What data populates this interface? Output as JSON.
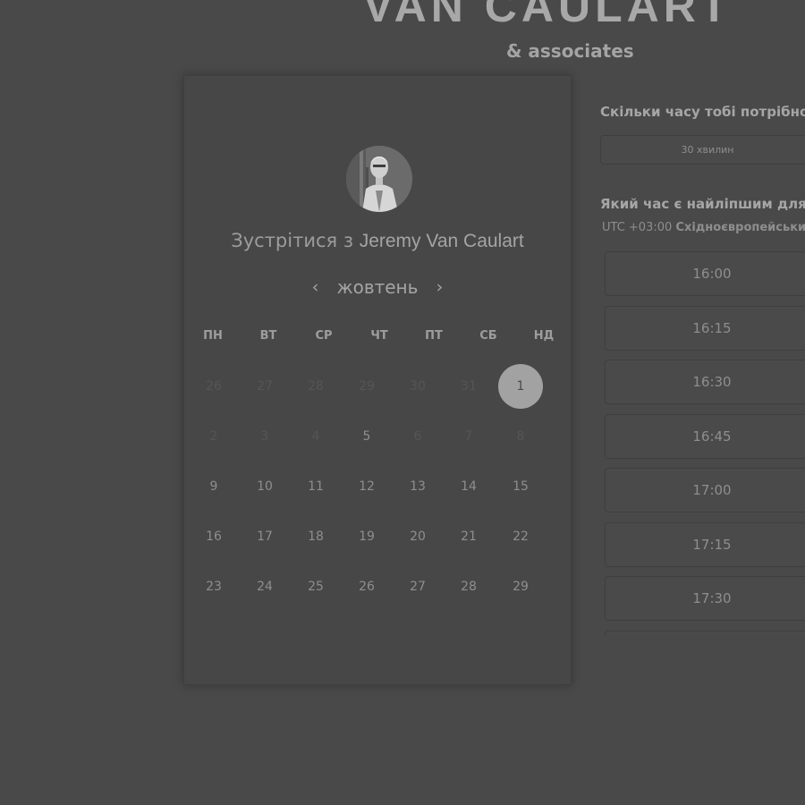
{
  "brand": {
    "name": "VAN CAULART",
    "tagline": "& associates"
  },
  "scheduler": {
    "title_prefix": "Зустрітися з",
    "host_name": "Jeremy Van Caulart",
    "calendar": {
      "month": "жовтень",
      "prev_icon": "chevron-left-icon",
      "next_icon": "chevron-right-icon",
      "weekdays": [
        "ПН",
        "ВТ",
        "СР",
        "ЧТ",
        "ПТ",
        "СБ",
        "НД"
      ],
      "weeks": [
        [
          {
            "d": "26",
            "s": "muted"
          },
          {
            "d": "27",
            "s": "muted"
          },
          {
            "d": "28",
            "s": "muted"
          },
          {
            "d": "29",
            "s": "muted"
          },
          {
            "d": "30",
            "s": "muted"
          },
          {
            "d": "31",
            "s": "muted"
          },
          {
            "d": "1",
            "s": "selected"
          }
        ],
        [
          {
            "d": "2",
            "s": "muted"
          },
          {
            "d": "3",
            "s": "muted"
          },
          {
            "d": "4",
            "s": "muted"
          },
          {
            "d": "5",
            "s": "avail"
          },
          {
            "d": "6",
            "s": "muted"
          },
          {
            "d": "7",
            "s": "muted"
          },
          {
            "d": "8",
            "s": "muted"
          }
        ],
        [
          {
            "d": "9",
            "s": "avail"
          },
          {
            "d": "10",
            "s": "avail"
          },
          {
            "d": "11",
            "s": "avail"
          },
          {
            "d": "12",
            "s": "avail"
          },
          {
            "d": "13",
            "s": "avail"
          },
          {
            "d": "14",
            "s": "avail"
          },
          {
            "d": "15",
            "s": "avail"
          }
        ],
        [
          {
            "d": "16",
            "s": "avail"
          },
          {
            "d": "17",
            "s": "avail"
          },
          {
            "d": "18",
            "s": "avail"
          },
          {
            "d": "19",
            "s": "avail"
          },
          {
            "d": "20",
            "s": "avail"
          },
          {
            "d": "21",
            "s": "avail"
          },
          {
            "d": "22",
            "s": "avail"
          }
        ],
        [
          {
            "d": "23",
            "s": "avail"
          },
          {
            "d": "24",
            "s": "avail"
          },
          {
            "d": "25",
            "s": "avail"
          },
          {
            "d": "26",
            "s": "avail"
          },
          {
            "d": "27",
            "s": "avail"
          },
          {
            "d": "28",
            "s": "avail"
          },
          {
            "d": "29",
            "s": "avail"
          }
        ]
      ]
    }
  },
  "booking": {
    "duration_question": "Скільки часу тобі потрібно?",
    "duration_value": "30 хвилин",
    "time_question": "Який час є найліпшим для ва",
    "timezone_offset": "UTC +03:00",
    "timezone_name": "Східноєвропейський",
    "slots": [
      "16:00",
      "16:15",
      "16:30",
      "16:45",
      "17:00",
      "17:15",
      "17:30"
    ]
  },
  "colors": {
    "background": "#494949",
    "panel": "#474747",
    "selected_day": "#a2a2a2",
    "muted_day": "#555555",
    "text": "#8e8e8e"
  }
}
